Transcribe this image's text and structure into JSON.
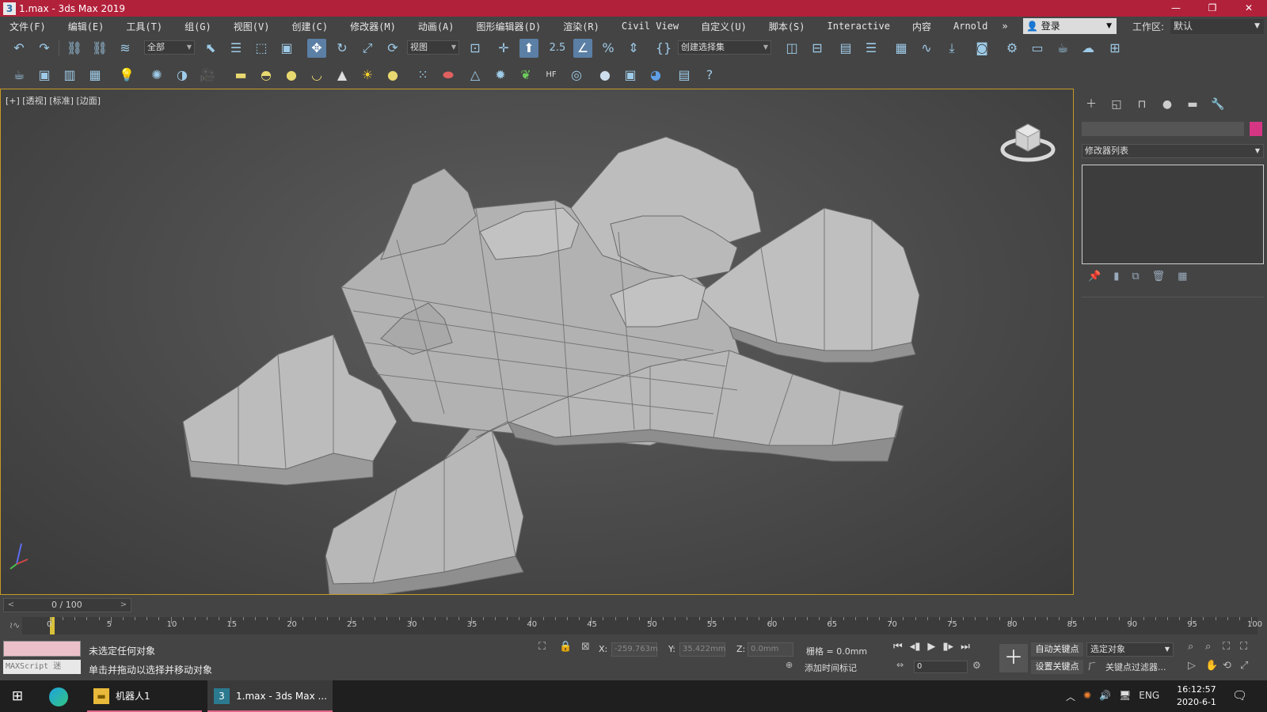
{
  "window": {
    "title": "1.max - 3ds Max 2019",
    "app_icon": "3",
    "minimize_label": "—",
    "restore_label": "❐",
    "close_label": "✕"
  },
  "menu": {
    "items": [
      "文件(F)",
      "编辑(E)",
      "工具(T)",
      "组(G)",
      "视图(V)",
      "创建(C)",
      "修改器(M)",
      "动画(A)",
      "图形编辑器(D)",
      "渲染(R)",
      "Civil View",
      "自定义(U)",
      "脚本(S)",
      "Interactive",
      "内容",
      "Arnold"
    ],
    "overflow": "»",
    "login": "登录",
    "workspace_label": "工作区:",
    "workspace_value": "默认"
  },
  "toolbar": {
    "selection_filter": "全部",
    "ref_coord": "视图",
    "named_selection": "创建选择集",
    "snap_label": "2.5"
  },
  "viewport": {
    "label": "[+] [透视] [标准] [边面]",
    "background": "#4d4d4d",
    "model_color": "#b4b4b4"
  },
  "command_panel": {
    "modifier_list": "修改器列表",
    "object_color": "#d43684"
  },
  "timeline": {
    "current": "0 / 100",
    "ticks": [
      0,
      5,
      10,
      15,
      20,
      25,
      30,
      35,
      40,
      45,
      50,
      55,
      60,
      65,
      70,
      75,
      80,
      85,
      90,
      95,
      100
    ]
  },
  "status": {
    "maxscript": "MAXScript 迷",
    "line1": "未选定任何对象",
    "line2": "单击并拖动以选择并移动对象",
    "x_label": "X:",
    "x_value": "-259.763m",
    "y_label": "Y:",
    "y_value": "35.422mm",
    "z_label": "Z:",
    "z_value": "0.0mm",
    "grid": "栅格 = 0.0mm",
    "add_time_tag": "添加时间标记",
    "frame_value": "0",
    "auto_key": "自动关键点",
    "set_key": "设置关键点",
    "selected_object": "选定对象",
    "key_filter": "关键点过滤器..."
  },
  "taskbar": {
    "apps": [
      {
        "label": "机器人1"
      },
      {
        "label": "1.max - 3ds Max ..."
      }
    ],
    "lang": "ENG",
    "time": "16:12:57",
    "date": "2020-6-1"
  }
}
